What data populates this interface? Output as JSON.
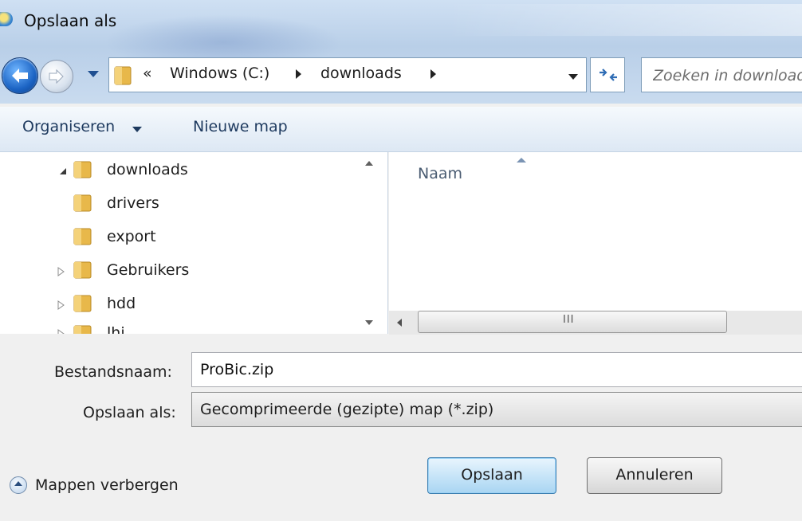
{
  "window": {
    "title": "Opslaan als"
  },
  "address_bar": {
    "overflow_chevron": "«",
    "crumbs": [
      "Windows (C:)",
      "downloads"
    ]
  },
  "search": {
    "placeholder": "Zoeken in downloads"
  },
  "command_bar": {
    "organize_label": "Organiseren",
    "new_folder_label": "Nieuwe map"
  },
  "tree": {
    "items": [
      {
        "label": "downloads",
        "state": "expanded"
      },
      {
        "label": "drivers",
        "state": "none"
      },
      {
        "label": "export",
        "state": "none"
      },
      {
        "label": "Gebruikers",
        "state": "collapsed"
      },
      {
        "label": "hdd",
        "state": "collapsed"
      },
      {
        "label": "lhi",
        "state": "collapsed"
      }
    ]
  },
  "file_list": {
    "column_name": "Naam",
    "scroll_grip": "III"
  },
  "form": {
    "filename_label": "Bestandsnaam:",
    "filename_value": "ProBic.zip",
    "type_label": "Opslaan als:",
    "type_value": "Gecomprimeerde (gezipte) map (*.zip)"
  },
  "buttons": {
    "save": "Opslaan",
    "cancel": "Annuleren",
    "hide_folders": "Mappen verbergen"
  },
  "colors": {
    "folder": "#e8b84a",
    "accent": "#3c7fb1"
  }
}
